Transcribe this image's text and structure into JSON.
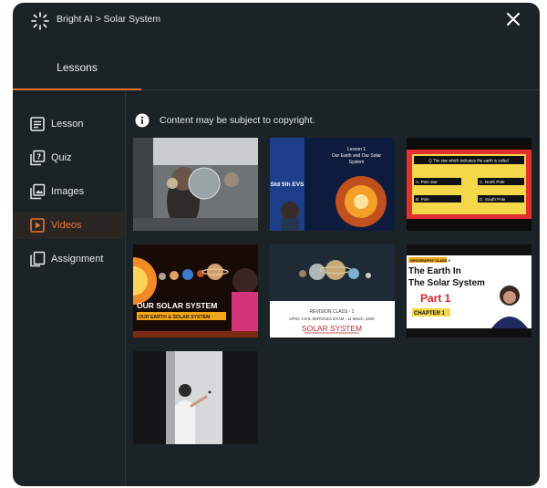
{
  "header": {
    "breadcrumb": "Bright AI > Solar System",
    "logo_icon": "sparkle-logo-icon",
    "close_icon": "close-icon"
  },
  "tabs": [
    {
      "label": "Lessons",
      "active": true
    }
  ],
  "sidebar": {
    "items": [
      {
        "label": "Lesson",
        "icon": "lesson-icon",
        "active": false
      },
      {
        "label": "Quiz",
        "icon": "quiz-icon",
        "active": false
      },
      {
        "label": "Images",
        "icon": "images-icon",
        "active": false
      },
      {
        "label": "Videos",
        "icon": "videos-icon",
        "active": true
      },
      {
        "label": "Assignment",
        "icon": "assignment-icon",
        "active": false
      }
    ]
  },
  "notice": {
    "icon": "info-icon",
    "text": "Content may be subject to copyright."
  },
  "videos": [
    {
      "name": "video-thumbnail-planet-models"
    },
    {
      "name": "video-thumbnail-std-5th-evs",
      "lines": [
        "Lesson 1",
        "Our Earth and Our Solar",
        "System",
        "Std 5th EVS"
      ]
    },
    {
      "name": "video-thumbnail-earth-quiz",
      "question": "Q The star which indicates the earth is called",
      "options": [
        "A. Pole star",
        "C. North Pole",
        "B. Pole",
        "D. South Pole"
      ]
    },
    {
      "name": "video-thumbnail-our-solar-system",
      "lines": [
        "OUR SOLAR SYSTEM",
        "OUR EARTH & SOLAR SYSTEM"
      ]
    },
    {
      "name": "video-thumbnail-revision-class",
      "lines": [
        "REVISION CLASS - 1",
        "UPSC CIVIL SERVICES EXAM - 11 March, 2020",
        "SOLAR SYSTEM"
      ]
    },
    {
      "name": "video-thumbnail-earth-in-solar-system",
      "lines": [
        "GEOGRAPHY CLASS 6",
        "The Earth In",
        "The Solar System",
        "Part 1",
        "CHAPTER 1"
      ]
    },
    {
      "name": "video-thumbnail-whiteboard-lesson"
    }
  ],
  "colors": {
    "panel": "#1b2326",
    "accent": "#f0742a",
    "active_bg": "#2a2624"
  }
}
